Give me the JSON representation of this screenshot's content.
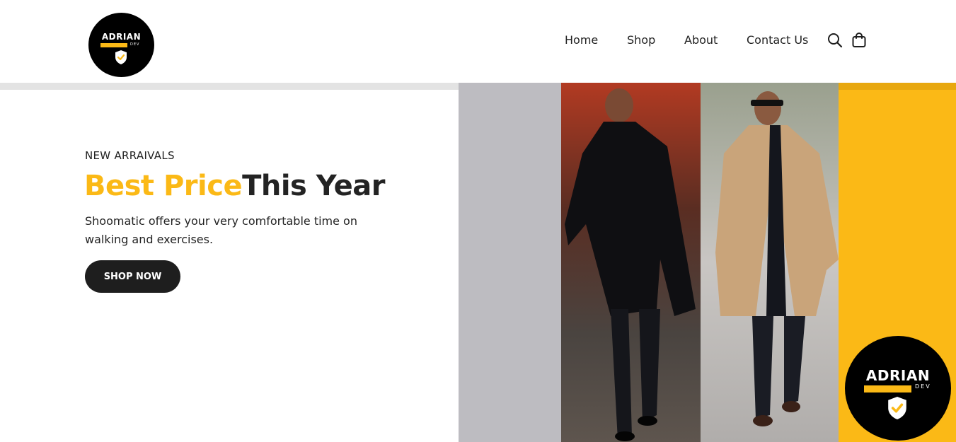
{
  "logo": {
    "brand": "ADRIAN",
    "sub": "DEV"
  },
  "nav": {
    "items": [
      {
        "label": "Home"
      },
      {
        "label": "Shop"
      },
      {
        "label": "About"
      },
      {
        "label": "Contact Us"
      }
    ],
    "icons": [
      "search-icon",
      "shopping-bag-icon"
    ]
  },
  "hero": {
    "eyebrow": "NEW ARRAIVALS",
    "headline_highlight": "Best Price",
    "headline_rest": "This Year",
    "description": "Shoomatic offers your very comfortable time on walking and exercises.",
    "cta_label": "SHOP NOW"
  },
  "badge": {
    "brand": "ADRIAN",
    "sub": "DEV"
  },
  "colors": {
    "accent": "#fbb916",
    "dark": "#1e1e1e",
    "panel_grey": "#bdbcc1",
    "header_bg": "#ffffff"
  }
}
